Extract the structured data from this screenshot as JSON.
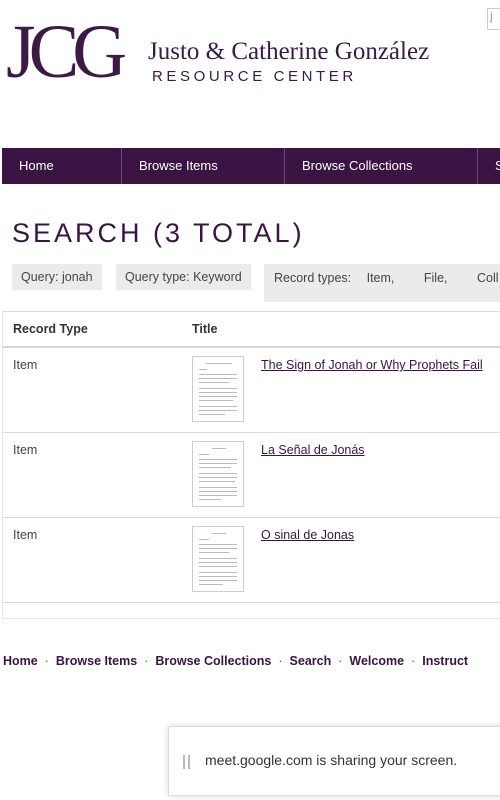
{
  "header": {
    "logo_mark": "JCG",
    "org_name": "Justo & Catherine González",
    "org_subtitle": "RESOURCE CENTER",
    "corner_char": "j"
  },
  "nav": {
    "items": [
      {
        "label": "Home"
      },
      {
        "label": "Browse Items"
      },
      {
        "label": "Browse Collections"
      },
      {
        "label": "S"
      }
    ]
  },
  "search": {
    "title": "SEARCH (3 TOTAL)",
    "filters": {
      "query": "Query: jonah",
      "query_type": "Query type: Keyword",
      "record_types_label": "Record types:",
      "record_types": [
        "Item,",
        "File,",
        "Coll"
      ]
    },
    "table": {
      "headers": {
        "record_type": "Record Type",
        "title": "Title"
      },
      "rows": [
        {
          "type": "Item",
          "title": "The Sign of Jonah or Why Prophets Fail"
        },
        {
          "type": "Item",
          "title": "La Señal de Jonás"
        },
        {
          "type": "Item",
          "title": "O sinal de Jonas"
        }
      ]
    }
  },
  "footer": {
    "links": [
      "Home",
      "Browse Items",
      "Browse Collections",
      "Search",
      "Welcome",
      "Instruct"
    ],
    "separator": "·"
  },
  "share_bar": {
    "message": "meet.google.com is sharing your screen."
  },
  "colors": {
    "brand": "#3a1442",
    "nav_bg": "#3a1442",
    "chip_bg": "#ebebeb"
  }
}
